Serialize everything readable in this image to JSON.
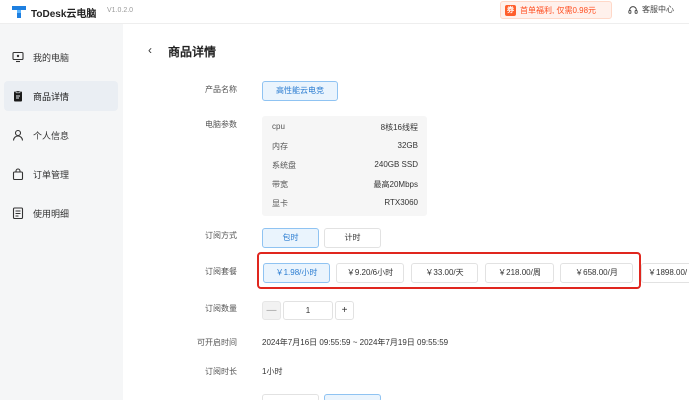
{
  "app": {
    "name": "ToDesk云电脑",
    "version": "V1.0.2.0"
  },
  "promo": {
    "badge": "券",
    "text": "首单福利, 仅需0.98元"
  },
  "support": {
    "label": "客服中心"
  },
  "sidebar": {
    "items": [
      {
        "label": "我的电脑",
        "icon": "monitor-icon",
        "active": false
      },
      {
        "label": "商品详情",
        "icon": "clipboard-icon",
        "active": true
      },
      {
        "label": "个人信息",
        "icon": "user-icon",
        "active": false
      },
      {
        "label": "订单管理",
        "icon": "bag-icon",
        "active": false
      },
      {
        "label": "使用明细",
        "icon": "list-icon",
        "active": false
      }
    ]
  },
  "page": {
    "back": "‹",
    "title": "商品详情"
  },
  "form": {
    "product_name_label": "产品名称",
    "product_name_value": "高性能云电竞",
    "specs_label": "电脑参数",
    "specs": [
      {
        "key": "cpu",
        "value": "8核16线程"
      },
      {
        "key": "内存",
        "value": "32GB"
      },
      {
        "key": "系统盘",
        "value": "240GB SSD"
      },
      {
        "key": "带宽",
        "value": "最高20Mbps"
      },
      {
        "key": "显卡",
        "value": "RTX3060"
      }
    ],
    "subscribe_mode_label": "订阅方式",
    "subscribe_modes": [
      "包时",
      "计时"
    ],
    "subscribe_mode_selected": "包时",
    "plan_label": "订阅套餐",
    "plans": [
      "￥1.98/小时",
      "￥9.20/6小时",
      "￥33.00/天",
      "￥218.00/周",
      "￥658.00/月",
      "￥1898.00/"
    ],
    "plan_selected": "￥1.98/小时",
    "quantity_label": "订阅数量",
    "quantity_minus": "—",
    "quantity_value": "1",
    "quantity_plus": "+",
    "start_time_label": "可开启时间",
    "start_time_value": "2024年7月16日 09:55:59 ~ 2024年7月19日 09:55:59",
    "duration_label": "订阅时长",
    "duration_value": "1小时"
  },
  "colors": {
    "accent": "#2a7cd1",
    "highlight": "#e0261e",
    "promo": "#ff4d1f"
  }
}
